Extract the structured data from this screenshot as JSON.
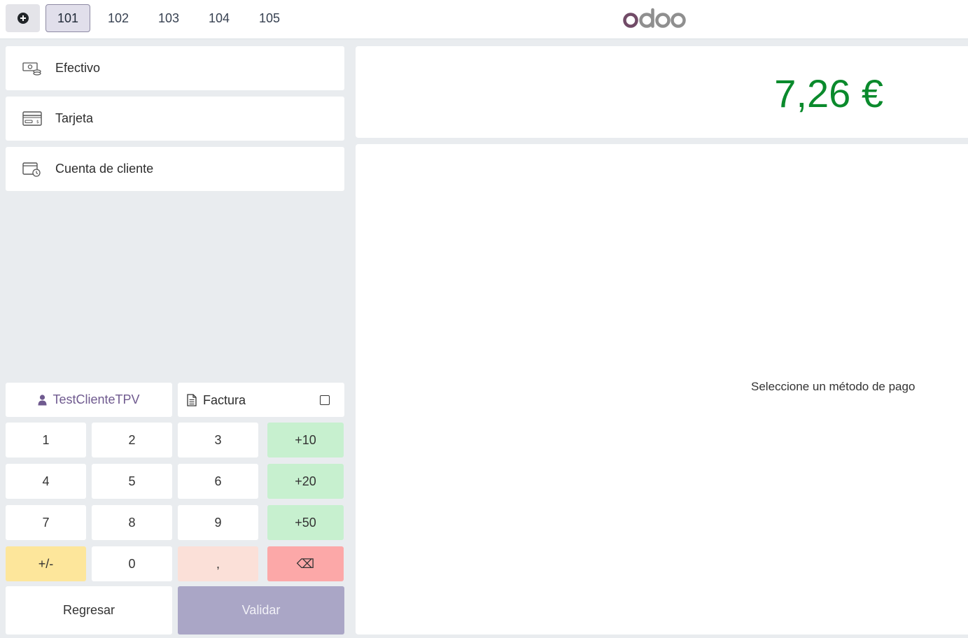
{
  "header": {
    "new_order_icon": "plus-circle-icon",
    "orders": [
      "101",
      "102",
      "103",
      "104",
      "105"
    ],
    "active_order": "101",
    "logo": "odoo",
    "logo_colors": {
      "o_first": "#714B67",
      "rest": "#8f8f8f"
    }
  },
  "payment_methods": [
    {
      "label": "Efectivo",
      "icon": "cash-icon"
    },
    {
      "label": "Tarjeta",
      "icon": "card-icon"
    },
    {
      "label": "Cuenta de cliente",
      "icon": "customer-account-icon"
    }
  ],
  "customer": {
    "label": "TestClienteTPV",
    "icon": "user-icon"
  },
  "invoice": {
    "label": "Factura",
    "icon": "document-icon",
    "checked": false
  },
  "numpad": {
    "rows": [
      [
        "1",
        "2",
        "3",
        "+10"
      ],
      [
        "4",
        "5",
        "6",
        "+20"
      ],
      [
        "7",
        "8",
        "9",
        "+50"
      ],
      [
        "+/-",
        "0",
        ",",
        "⌫"
      ]
    ]
  },
  "actions": {
    "back": "Regresar",
    "validate": "Validar"
  },
  "summary": {
    "total": "7,26 €",
    "empty_message": "Seleccione un método de pago"
  },
  "colors": {
    "total": "#0a8a2c",
    "quick_add": "#c7f0cf",
    "sign_key": "#fde69b",
    "decimal_key": "#fbe0d8",
    "backspace_key": "#fca8a8",
    "validate": "#aaa6c6",
    "active_tab": "#e1dfeb"
  }
}
